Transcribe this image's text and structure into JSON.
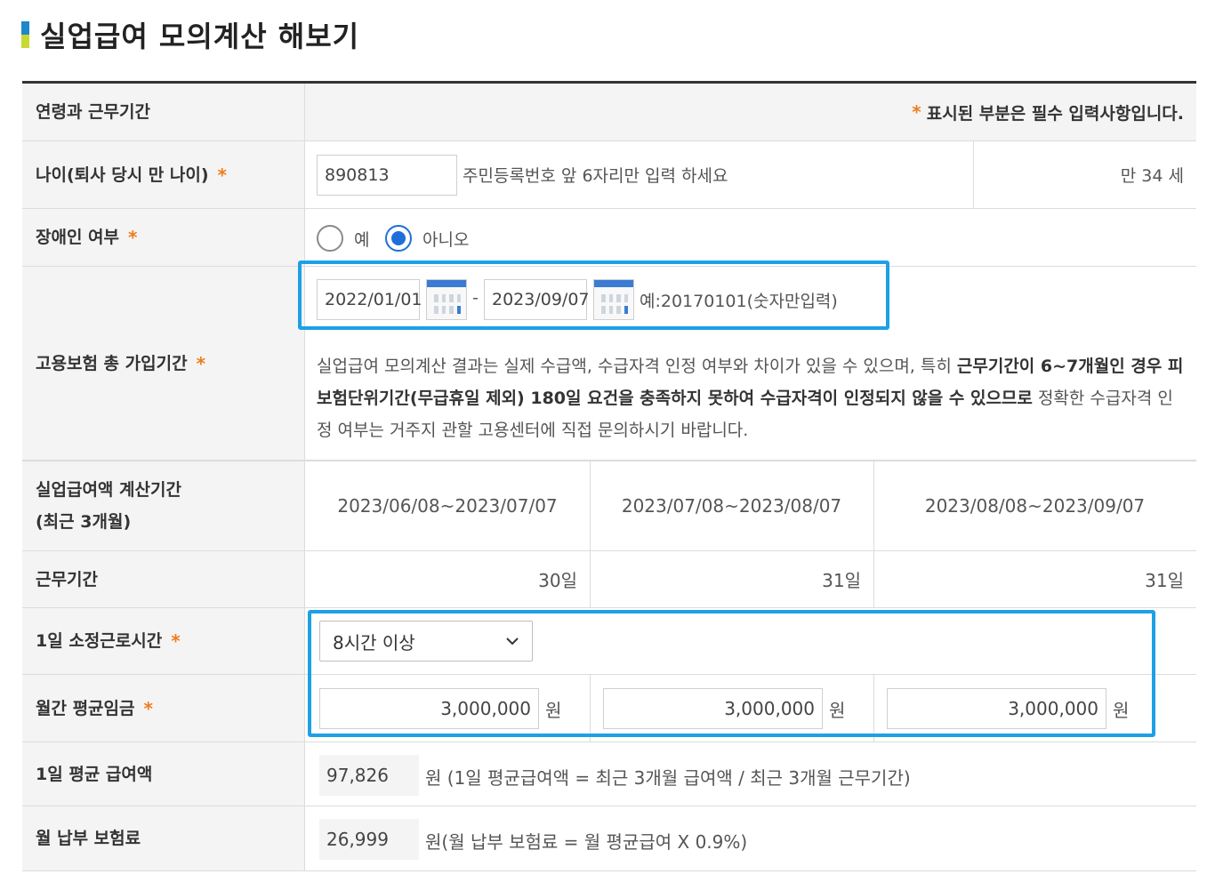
{
  "page": {
    "title": "실업급여 모의계산 해보기"
  },
  "header_row": {
    "label": "연령과 근무기간",
    "required_mark": "*",
    "required_note": "표시된 부분은 필수 입력사항입니다."
  },
  "age": {
    "label": "나이(퇴사 당시 만 나이)",
    "value": "890813",
    "hint": "주민등록번호 앞 6자리만 입력 하세요",
    "result": "만 34 세"
  },
  "disabled": {
    "label": "장애인 여부",
    "options": [
      "예",
      "아니오"
    ],
    "selected": "아니오"
  },
  "insurance_period": {
    "label": "고용보험 총 가입기간",
    "start_date": "2022/01/01",
    "separator": "-",
    "end_date": "2023/09/07",
    "example": "예:20170101(숫자만입력)",
    "notice_part1": "실업급여 모의계산 결과는 실제 수급액, 수급자격 인정 여부와 차이가 있을 수 있으며, 특히 ",
    "notice_bold": "근무기간이 6~7개월인 경우 피보험단위기간(무급휴일 제외) 180일 요건을 충족하지 못하여 수급자격이 인정되지 않을 수 있으므로",
    "notice_part2": " 정확한 수급자격 인정 여부는 거주지 관할 고용센터에 직접 문의하시기 바랍니다."
  },
  "calc_period": {
    "label_line1": "실업급여액 계산기간",
    "label_line2": "(최근 3개월)",
    "periods": [
      "2023/06/08~2023/07/07",
      "2023/07/08~2023/08/07",
      "2023/08/08~2023/09/07"
    ]
  },
  "work_days": {
    "label": "근무기간",
    "values": [
      "30일",
      "31일",
      "31일"
    ]
  },
  "daily_hours": {
    "label": "1일 소정근로시간",
    "selected": "8시간 이상"
  },
  "monthly_wage": {
    "label": "월간 평균임금",
    "values": [
      "3,000,000",
      "3,000,000",
      "3,000,000"
    ],
    "unit": "원"
  },
  "daily_avg": {
    "label": "1일 평균 급여액",
    "value": "97,826",
    "note": "원 (1일 평균급여액 = 최근 3개월 급여액 / 최근 3개월 근무기간)"
  },
  "monthly_premium": {
    "label": "월 납부 보험료",
    "value": "26,999",
    "note": "원(월 납부 보험료 = 월 평균급여 X 0.9%)"
  },
  "colors": {
    "accent": "#1da0e6",
    "required": "#f07c1e",
    "radio": "#1e6fd9"
  }
}
